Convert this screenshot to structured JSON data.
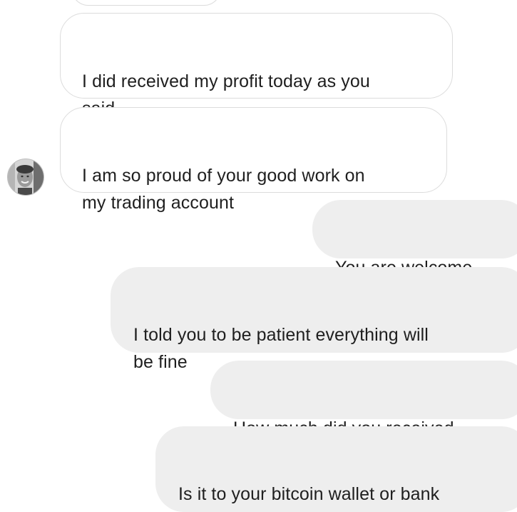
{
  "conversation": {
    "messages": [
      {
        "direction": "incoming",
        "text": ""
      },
      {
        "direction": "incoming",
        "text": "I did received my profit today as you\nsaid"
      },
      {
        "direction": "incoming",
        "text": "I am so proud of your good work on\nmy trading account"
      },
      {
        "direction": "outgoing",
        "text": "You are welcome"
      },
      {
        "direction": "outgoing",
        "text": "I told you to be patient everything will\nbe fine"
      },
      {
        "direction": "outgoing",
        "text": "How much did you received"
      },
      {
        "direction": "outgoing",
        "text": "Is it to your bitcoin wallet or bank\naccount?"
      }
    ],
    "avatar": {
      "icon": "contact-avatar"
    },
    "colors": {
      "incoming_bubble": "#ffffff",
      "incoming_border": "#dcdcdc",
      "outgoing_bubble": "#eeeeee",
      "text": "#1f1f1f"
    }
  }
}
